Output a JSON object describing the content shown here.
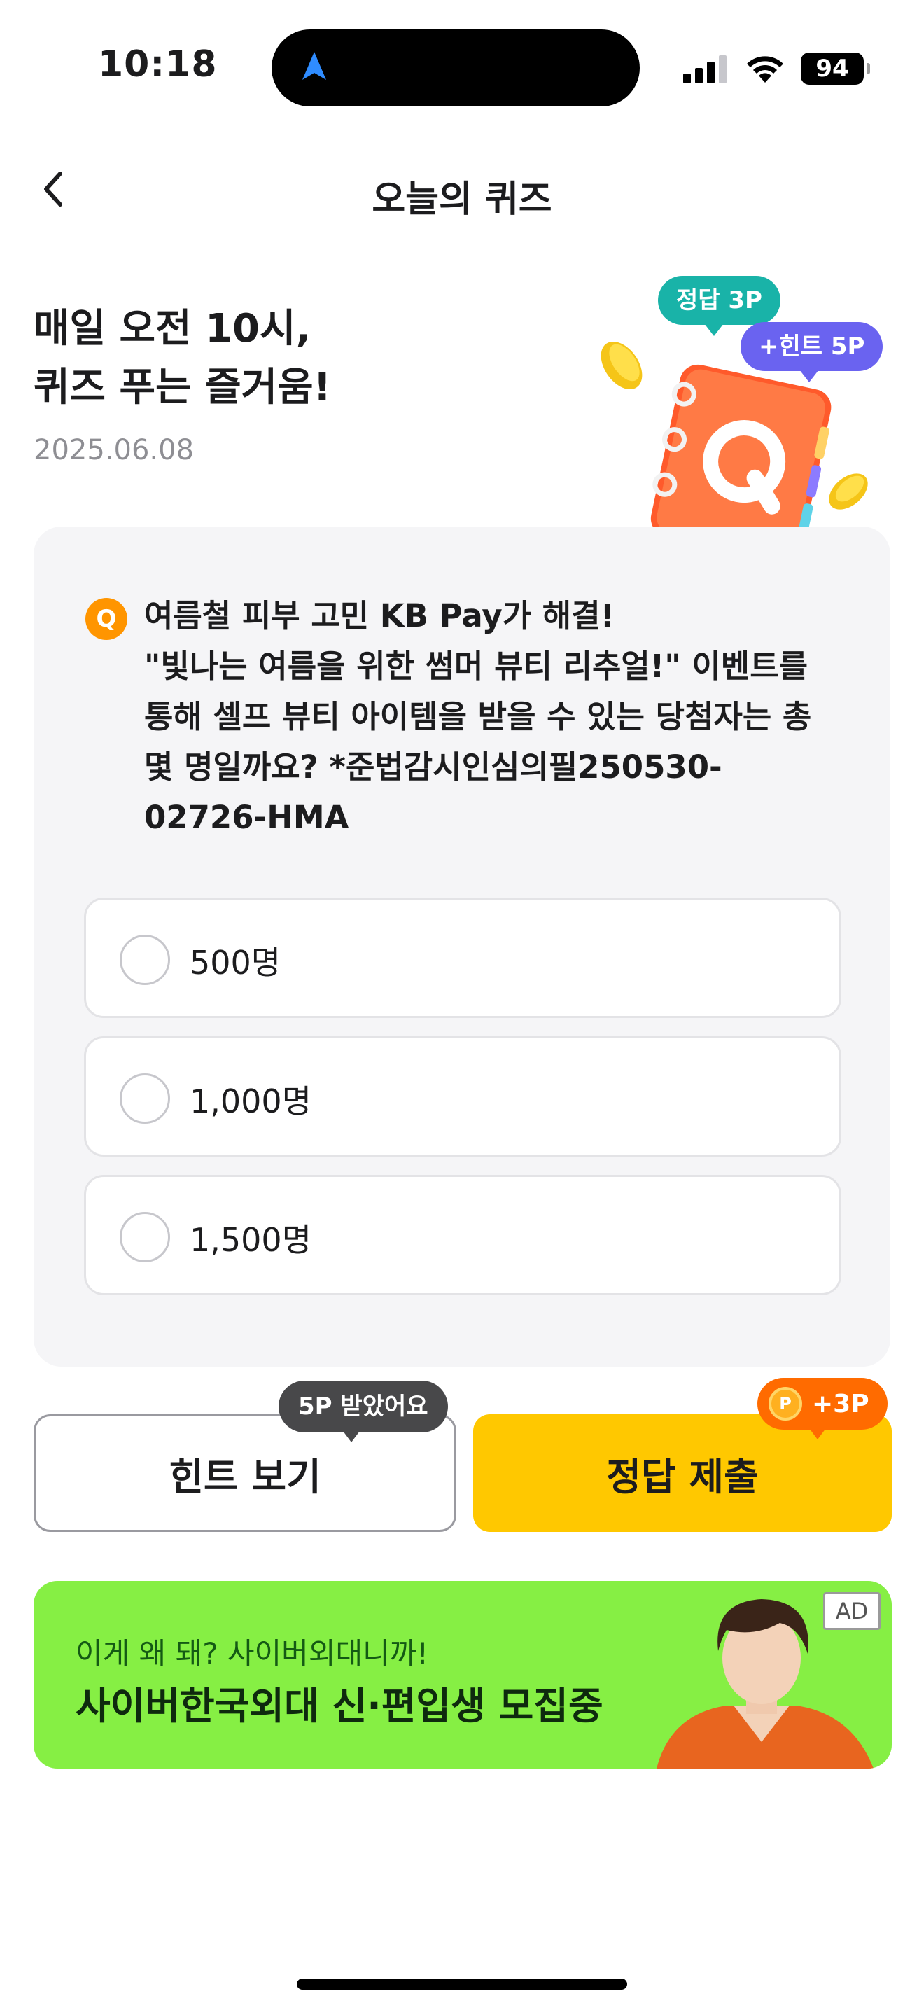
{
  "status_bar": {
    "time": "10:18",
    "battery": "94",
    "icons": [
      "location-arrow-icon",
      "cellular-signal-icon",
      "wifi-icon",
      "battery-icon"
    ]
  },
  "header": {
    "title": "오늘의 퀴즈",
    "back_icon": "chevron-left-icon"
  },
  "hero": {
    "title_line1": "매일 오전 10시,",
    "title_line2": "퀴즈 푸는 즐거움!",
    "date": "2025.06.08",
    "bubble_answer": "정답 3P",
    "bubble_hint": "+힌트 5P",
    "notebook_letter": "Q"
  },
  "quiz": {
    "badge": "Q",
    "question_line1": "여름철 피부 고민 KB Pay가 해결!",
    "question_line2": "\"빛나는 여름을 위한 썸머 뷰티 리추얼!\" 이벤트를",
    "question_line3": "통해 셀프 뷰티 아이템을 받을 수 있는 당첨자는 총",
    "question_line4": "몇 명일까요? *준법감시인심의필250530-",
    "question_line5": "02726-HMA",
    "options": [
      {
        "label": "500명"
      },
      {
        "label": "1,000명"
      },
      {
        "label": "1,500명"
      }
    ]
  },
  "actions": {
    "hint_label": "힌트 보기",
    "hint_tooltip": "5P 받았어요",
    "submit_label": "정답 제출",
    "point_coin": "P",
    "point_tag": "+3P"
  },
  "ad": {
    "subtitle": "이게 왜 돼? 사이버외대니까!",
    "title": "사이버한국외대 신·편입생 모집중",
    "badge": "AD"
  },
  "colors": {
    "accent_yellow": "#ffc800",
    "teal": "#19b3a8",
    "purple": "#6a63f0",
    "orange": "#ff6b00",
    "ad_green": "#86ef44"
  }
}
